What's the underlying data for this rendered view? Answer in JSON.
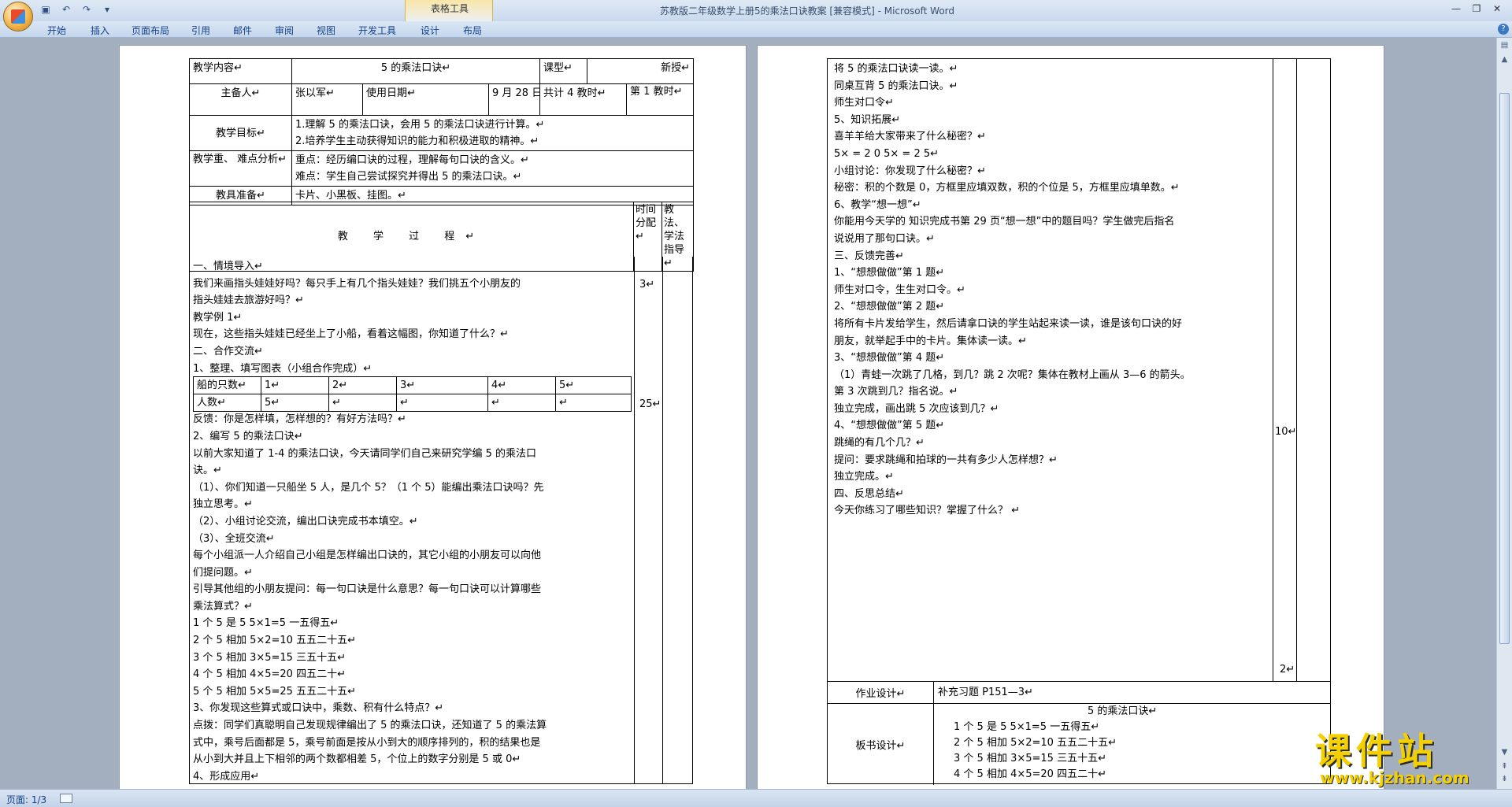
{
  "window": {
    "title": "苏教版二年级数学上册5的乘法口诀教案 [兼容模式] - Microsoft Word",
    "context_tab": "表格工具",
    "controls": [
      "—",
      "❐",
      "✕"
    ]
  },
  "ribbon": {
    "tabs": [
      "开始",
      "插入",
      "页面布局",
      "引用",
      "邮件",
      "审阅",
      "视图",
      "开发工具",
      "设计",
      "布局"
    ]
  },
  "status": {
    "page": "页面: 1/3"
  },
  "page1": {
    "r1": {
      "l1": "教学内容↵",
      "v1": "5 的乘法口诀↵",
      "l2": "课型↵",
      "v2": "新授↵"
    },
    "r2": {
      "l1": "主备人↵",
      "v1": "张以军↵",
      "l2": "使用日期↵",
      "v2": "9 月 28 日↵",
      "l3": "共计 4   教时↵",
      "v3": "第    1 教时↵"
    },
    "goals": {
      "label": "教学目标↵",
      "lines": [
        "1.理解 5 的乘法口诀，会用 5 的乘法口诀进行计算。↵",
        "2.培养学生主动获得知识的能力和积极进取的精神。↵"
      ]
    },
    "keys": {
      "label": "教学重、  难点分析↵",
      "lines": [
        "重点：经历编口诀的过程，理解每句口诀的含义。↵",
        "难点：学生自己尝试探究并得出 5 的乘法口诀。↵"
      ]
    },
    "tools": {
      "label": "教具准备↵",
      "value": "卡片、小黑板、挂图。↵"
    },
    "proc_header": {
      "title": "教 学 过 程↵",
      "time": "时间分配↵",
      "note": "教法、学法指导↵"
    },
    "proc_lines": [
      "一、情境导入↵",
      "      我们来画指头娃娃好吗？每只手上有几个指头娃娃？我们挑五个小朋友的",
      "指头娃娃去旅游好吗？↵",
      "教学例 1↵",
      "现在，这些指头娃娃已经坐上了小船，看着这幅图，你知道了什么？↵",
      "二、合作交流↵",
      "1、整理、填写图表（小组合作完成）↵",
      "",
      "",
      "反馈：你是怎样填，怎样想的？有好方法吗？↵",
      "2、编写 5 的乘法口诀↵",
      "以前大家知道了 1-4 的乘法口诀，今天请同学们自己来研究学编 5 的乘法口",
      "诀。↵",
      "（1）、你们知道一只船坐 5 人，是几个 5？（1 个 5）能编出乘法口诀吗？先",
      "独立思考。↵",
      "（2）、小组讨论交流，编出口诀完成书本填空。↵",
      "（3）、全班交流↵",
      "每个小组派一人介绍自己小组是怎样编出口诀的，其它小组的小朋友可以向他",
      "们提问题。↵",
      "引导其他组的小朋友提问：每一句口诀是什么意思？每一句口诀可以计算哪些",
      "乘法算式？↵",
      "  1 个 5 是 5          5×1=5              一五得五↵",
      "  2 个 5 相加         5×2=10             五五二十五↵",
      "  3 个 5 相加         3×5=15             三五十五↵",
      "  4 个 5 相加         4×5=20             四五二十↵",
      "  5 个 5 相加         5×5=25             五五二十五↵",
      "3、你发现这些算式或口诀中，乘数、积有什么特点？↵",
      "点拨：同学们真聪明自己发现规律编出了 5 的乘法口诀，还知道了 5 的乘法算",
      "式中，乘号后面都是 5，乘号前面是按从小到大的顺序排列的，积的结果也是",
      "从小到大并且上下相邻的两个数都相差 5，个位上的数字分别是 5 或 0↵",
      "4、形成应用↵"
    ],
    "mini_table": {
      "rows": [
        [
          "船的只数↵",
          "1↵",
          "2↵",
          "3↵",
          "4↵",
          "5↵"
        ],
        [
          "人数↵",
          "5↵",
          "↵",
          "↵",
          "↵",
          "↵"
        ]
      ]
    },
    "time_marks": [
      "3↵",
      "25↵"
    ]
  },
  "page2": {
    "lines": [
      "将 5 的乘法口诀读一读。↵",
      "同桌互背 5 的乘法口诀。↵",
      "师生对口令↵",
      "5、知识拓展↵",
      "喜羊羊给大家带来了什么秘密？↵",
      "5×      = 2 0                      5×    =  2 5↵",
      "小组讨论：你发现了什么秘密？↵",
      "秘密：积的个数是 0，方框里应填双数，积的个位是 5，方框里应填单数。↵",
      "6、教学“想一想”↵",
      "你能用今天学的 知识完成书第 29 页“想一想”中的题目吗？学生做完后指名",
      "说说用了那句口诀。↵",
      "三、反馈完善↵",
      "     1、“想想做做”第 1 题↵",
      "师生对口令，生生对口令。↵",
      "     2、“想想做做”第 2 题↵",
      "将所有卡片发给学生，然后请拿口诀的学生站起来读一读，谁是该句口诀的好",
      "朋友，就举起手中的卡片。集体读一读。↵",
      "     3、“想想做做”第 4 题↵",
      "（1）青蛙一次跳了几格，到几？跳 2 次呢？集体在教材上画从 3—6 的箭头。",
      "第 3 次跳到几？指名说。↵",
      "独立完成，画出跳 5 次应该到几？↵",
      "     4、“想想做做”第 5 题↵",
      "跳绳的有几个几？↵",
      "提问：要求跳绳和拍球的一共有多少人怎样想？↵",
      "独立完成。↵",
      "四、反思总结↵",
      "今天你练习了哪些知识？掌握了什么？ ↵"
    ],
    "time_marks": [
      "10↵",
      "2↵"
    ],
    "homework": {
      "label": "作业设计↵",
      "value": "补充习题 P151—3↵"
    },
    "board": {
      "label": "板书设计↵",
      "title": "5 的乘法口诀↵",
      "lines": [
        "1 个 5 是 5          5×1=5          一五得五↵",
        "2 个 5 相加         5×2=10         五五二十五↵",
        "3 个 5 相加         3×5=15         三五十五↵",
        "4 个 5 相加         4×5=20         四五二十↵"
      ]
    }
  },
  "watermark": {
    "title": "课件站",
    "url": "www.kjzhan.com"
  }
}
